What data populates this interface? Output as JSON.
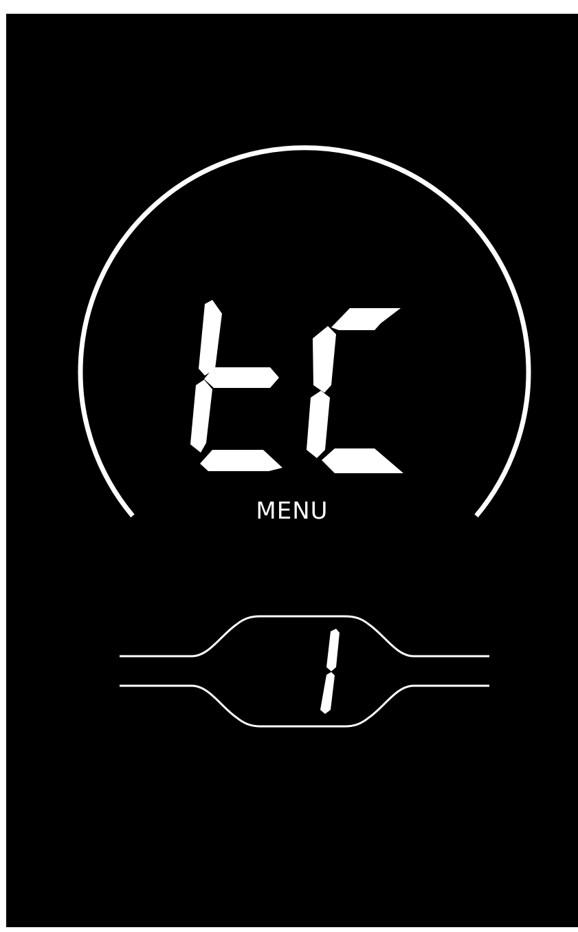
{
  "display": {
    "main_readout": "tC",
    "menu_label": "MENU",
    "assist_level": "1"
  },
  "colors": {
    "background": "#000000",
    "segment": "#ffffff",
    "frame": "#ffffff"
  }
}
